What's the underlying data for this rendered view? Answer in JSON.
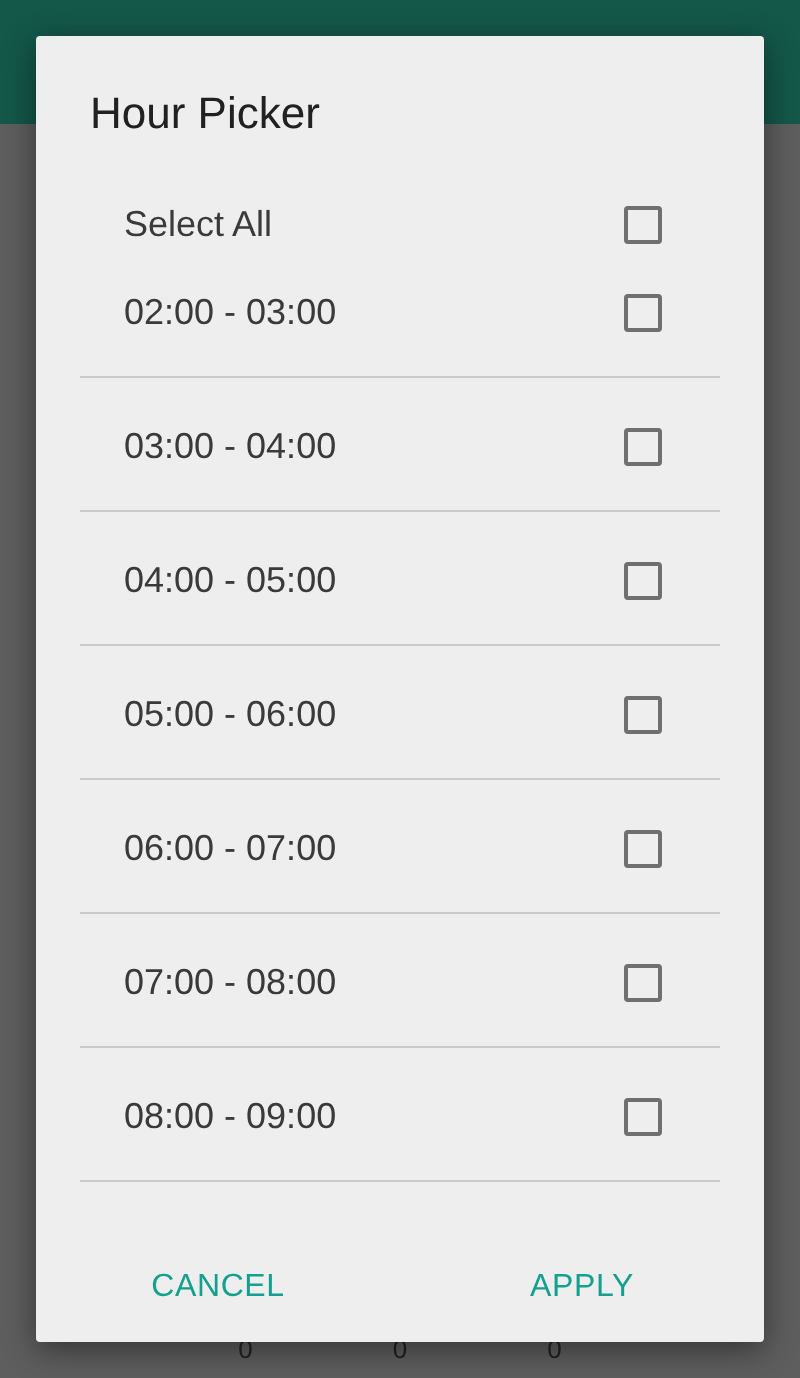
{
  "dialog": {
    "title": "Hour Picker",
    "select_all": {
      "label": "Select All",
      "checked": false
    },
    "hours": [
      {
        "label": "02:00 - 03:00",
        "checked": false
      },
      {
        "label": "03:00 - 04:00",
        "checked": false
      },
      {
        "label": "04:00 - 05:00",
        "checked": false
      },
      {
        "label": "05:00 - 06:00",
        "checked": false
      },
      {
        "label": "06:00 - 07:00",
        "checked": false
      },
      {
        "label": "07:00 - 08:00",
        "checked": false
      },
      {
        "label": "08:00 - 09:00",
        "checked": false
      }
    ],
    "buttons": [
      "CANCEL",
      "APPLY"
    ]
  },
  "background_values": [
    "0",
    "0",
    "0"
  ]
}
